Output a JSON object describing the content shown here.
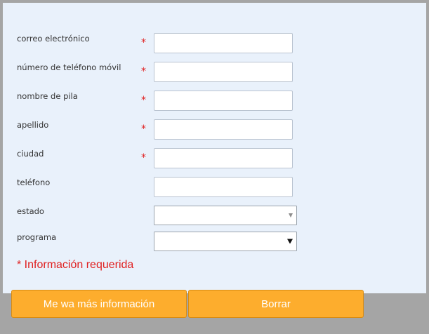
{
  "form": {
    "fields": [
      {
        "label": "correo electrónico",
        "required_mark": "*",
        "value": ""
      },
      {
        "label": "número de teléfono móvil",
        "required_mark": "*",
        "value": ""
      },
      {
        "label": "nombre de pila",
        "required_mark": "*",
        "value": ""
      },
      {
        "label": "apellido",
        "required_mark": "*",
        "value": ""
      },
      {
        "label": "ciudad",
        "required_mark": "*",
        "value": ""
      },
      {
        "label": "teléfono",
        "value": ""
      }
    ],
    "selects": [
      {
        "label": "estado",
        "selected": ""
      },
      {
        "label": "programa",
        "selected": ""
      }
    ],
    "required_note": "* Información requerida"
  },
  "actions": {
    "submit_label": "Me wa más información",
    "clear_label": "Borrar"
  },
  "colors": {
    "panel_bg": "#e9f1fb",
    "page_bg": "#a5a5a5",
    "required": "#e02020",
    "button": "#fdad2d"
  },
  "icons": {
    "select_arrow": "chevron-down-icon"
  }
}
